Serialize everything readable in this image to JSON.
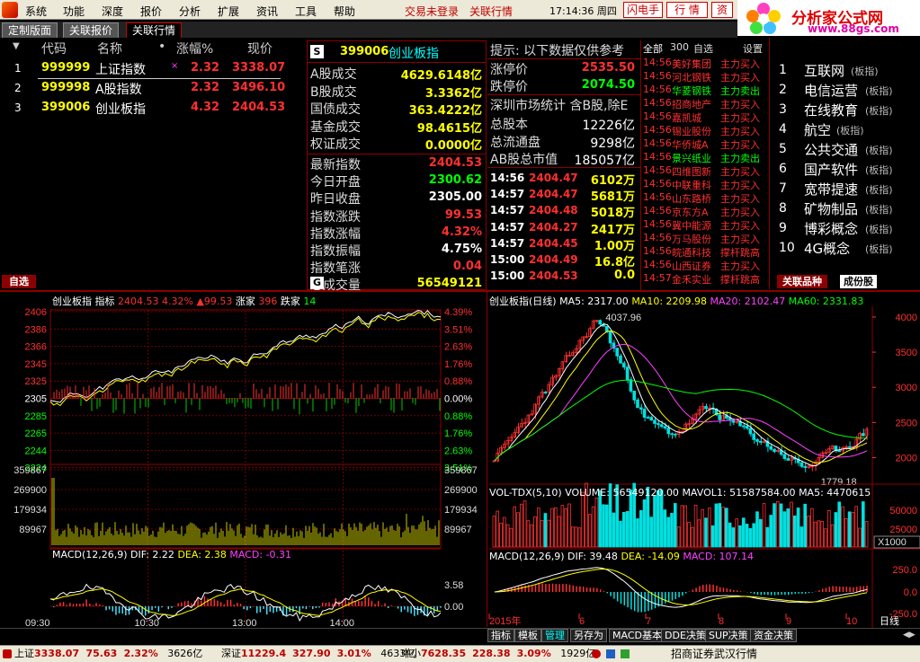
{
  "menu": {
    "items": [
      "系统",
      "功能",
      "深度",
      "报价",
      "分析",
      "扩展",
      "资讯",
      "工具",
      "帮助"
    ],
    "trade_status": "交易未登录",
    "related_quotes": "关联行情",
    "clock": "17:14:36 周四",
    "btn_flash": "闪电手",
    "btn_quote": "行 情",
    "btn_info": "资"
  },
  "brand": {
    "name": "分析家公式网",
    "url": "www.88gs.com"
  },
  "tabs": [
    "定制版面",
    "关联报价",
    "关联行情"
  ],
  "watchlist": {
    "headers": {
      "code": "代码",
      "name": "名称",
      "dot": "•",
      "change_pct": "涨幅%",
      "price": "现价"
    },
    "rows": [
      {
        "idx": "1",
        "code": "999999",
        "name": "上证指数",
        "mark": "×",
        "change": "2.32",
        "price": "3338.07"
      },
      {
        "idx": "2",
        "code": "999998",
        "name": "A股指数",
        "mark": "",
        "change": "2.32",
        "price": "3496.10"
      },
      {
        "idx": "3",
        "code": "399006",
        "name": "创业板指",
        "mark": "",
        "change": "4.32",
        "price": "2404.53"
      }
    ],
    "footer_tab": "自选"
  },
  "index_panel": {
    "badge": "S",
    "code": "399006",
    "name": "创业板指",
    "stats": [
      {
        "label": "A股成交",
        "value": "4629.6148亿",
        "color": "#ffff00"
      },
      {
        "label": "B股成交",
        "value": "3.3362亿",
        "color": "#ffff00"
      },
      {
        "label": "国债成交",
        "value": "363.4222亿",
        "color": "#ffff00"
      },
      {
        "label": "基金成交",
        "value": "98.4615亿",
        "color": "#ffff00"
      },
      {
        "label": "权证成交",
        "value": "0.0000亿",
        "color": "#ffff00"
      }
    ],
    "quote": [
      {
        "label": "最新指数",
        "value": "2404.53",
        "color": "#ff3030"
      },
      {
        "label": "今日开盘",
        "value": "2300.62",
        "color": "#00ff00"
      },
      {
        "label": "昨日收盘",
        "value": "2305.00",
        "color": "#ffffff"
      },
      {
        "label": "指数涨跌",
        "value": "99.53",
        "color": "#ff3030"
      },
      {
        "label": "指数涨幅",
        "value": "4.32%",
        "color": "#ff3030"
      },
      {
        "label": "指数振幅",
        "value": "4.75%",
        "color": "#ffffff"
      },
      {
        "label": "指数笔涨",
        "value": "0.04",
        "color": "#ff3030"
      },
      {
        "label": "总成交量",
        "value": "56549121",
        "color": "#ffff00"
      }
    ],
    "footer_badge": "G"
  },
  "hint_panel": {
    "tip": "提示: 以下数据仅供参考",
    "limit_up_label": "涨停价",
    "limit_up": "2535.50",
    "limit_down_label": "跌停价",
    "limit_down": "2074.50",
    "stat_title": "深圳市场统计 含B股,除E",
    "total_cap_label": "总股本",
    "total_cap": "12226亿",
    "float_cap_label": "总流通盘",
    "float_cap": "9298亿",
    "mkt_val_label": "AB股总市值",
    "mkt_val": "185057亿",
    "ticks": [
      {
        "time": "14:56",
        "price": "2404.47",
        "vol": "6102万"
      },
      {
        "time": "14:57",
        "price": "2404.47",
        "vol": "5681万"
      },
      {
        "time": "14:57",
        "price": "2404.48",
        "vol": "5018万"
      },
      {
        "time": "14:57",
        "price": "2404.27",
        "vol": "2417万"
      },
      {
        "time": "14:57",
        "price": "2404.45",
        "vol": "1.00万"
      },
      {
        "time": "15:00",
        "price": "2404.49",
        "vol": "16.8亿"
      },
      {
        "time": "15:00",
        "price": "2404.53",
        "vol": "0.0"
      }
    ]
  },
  "flow_panel": {
    "header_all": "全部",
    "header_count": "300",
    "header_self": "自选",
    "header_settings": "设置",
    "items": [
      {
        "time": "14:56",
        "name": "美好集团",
        "action": "主力买入",
        "color": "#ff3030"
      },
      {
        "time": "14:56",
        "name": "河北钢铁",
        "action": "主力买入",
        "color": "#ff3030"
      },
      {
        "time": "14:56",
        "name": "华菱钢铁",
        "action": "主力卖出",
        "color": "#00ff00"
      },
      {
        "time": "14:56",
        "name": "招商地产",
        "action": "主力买入",
        "color": "#ff3030"
      },
      {
        "time": "14:56",
        "name": "嘉凯城",
        "action": "主力买入",
        "color": "#ff3030"
      },
      {
        "time": "14:56",
        "name": "锡业股份",
        "action": "主力买入",
        "color": "#ff3030"
      },
      {
        "time": "14:56",
        "name": "华侨城A",
        "action": "主力买入",
        "color": "#ff3030"
      },
      {
        "time": "14:56",
        "name": "景兴纸业",
        "action": "主力卖出",
        "color": "#00ff00"
      },
      {
        "time": "14:56",
        "name": "四维图新",
        "action": "主力买入",
        "color": "#ff3030"
      },
      {
        "time": "14:56",
        "name": "中联重科",
        "action": "主力买入",
        "color": "#ff3030"
      },
      {
        "time": "14:56",
        "name": "山东路桥",
        "action": "主力买入",
        "color": "#ff3030"
      },
      {
        "time": "14:56",
        "name": "京东方A",
        "action": "主力买入",
        "color": "#ff3030"
      },
      {
        "time": "14:56",
        "name": "冀中能源",
        "action": "主力买入",
        "color": "#ff3030"
      },
      {
        "time": "14:56",
        "name": "万马股份",
        "action": "主力买入",
        "color": "#ff3030"
      },
      {
        "time": "14:56",
        "name": "皖通科技",
        "action": "撑杆跳高",
        "color": "#ff3030"
      },
      {
        "time": "14:56",
        "name": "山西证券",
        "action": "主力买入",
        "color": "#ff3030"
      },
      {
        "time": "14:57",
        "name": "金禾实业",
        "action": "撑杆跳高",
        "color": "#ff3030"
      }
    ]
  },
  "sector_panel": {
    "items": [
      {
        "idx": "1",
        "name": "互联网",
        "tag": "(板指)"
      },
      {
        "idx": "2",
        "name": "电信运营",
        "tag": "(板指)"
      },
      {
        "idx": "3",
        "name": "在线教育",
        "tag": "(板指)"
      },
      {
        "idx": "4",
        "name": "航空",
        "tag": "(板指)"
      },
      {
        "idx": "5",
        "name": "公共交通",
        "tag": "(板指)"
      },
      {
        "idx": "6",
        "name": "国产软件",
        "tag": "(板指)"
      },
      {
        "idx": "7",
        "name": "宽带提速",
        "tag": "(板指)"
      },
      {
        "idx": "8",
        "name": "矿物制品",
        "tag": "(板指)"
      },
      {
        "idx": "9",
        "name": "博彩概念",
        "tag": "(板指)"
      },
      {
        "idx": "10",
        "name": "4G概念",
        "tag": "(板指)"
      }
    ],
    "tab1": "关联品种",
    "tab2": "成份股"
  },
  "intraday": {
    "title": "创业板指 指标 2404.53 4.32% ▲99.53 涨家 396 跌家 14",
    "title_name": "创业板指",
    "title_ind": "指标",
    "title_price": "2404.53",
    "title_pct": "4.32%",
    "title_chg": "▲99.53",
    "title_up_label": "涨家",
    "title_up": "396",
    "title_down_label": "跌家",
    "title_down": "14",
    "y_left": [
      "2406",
      "2386",
      "2366",
      "2345",
      "2325",
      "2305",
      "2285",
      "2265",
      "2244",
      "2224"
    ],
    "y_right": [
      "4.39%",
      "3.51%",
      "2.63%",
      "1.76%",
      "0.88%",
      "0.00%",
      "0.88%",
      "1.76%",
      "2.63%",
      "3.51%"
    ],
    "vol_ticks": [
      "359867",
      "269900",
      "179934",
      "89967"
    ],
    "macd_label": "MACD(12,26,9)",
    "macd_dif": "DIF: 2.22",
    "macd_dea": "DEA: 2.38",
    "macd_val": "MACD: -0.31",
    "macd_ticks": [
      "3.58",
      "0.00"
    ],
    "time_ticks": [
      "09:30",
      "10:30",
      "13:00",
      "14:00"
    ]
  },
  "daily": {
    "title_name": "创业板指(日线)",
    "ma5": "MA5: 2317.00",
    "ma10": "MA10: 2209.98",
    "ma20": "MA20: 2102.47",
    "ma60": "MA60: 2331.83",
    "y_ticks": [
      "4000",
      "3500",
      "3000",
      "2500",
      "2000"
    ],
    "high_label": "4037.96",
    "low_label": "1779.18",
    "vol_title": "VOL-TDX(5,10)",
    "vol_volume": "VOLUME: 56549120.00",
    "vol_mavol1": "MAVOL1: 51587584.00",
    "vol_ma5": "MA5: 4470615",
    "vol_ticks": [
      "50000",
      "25000"
    ],
    "vol_unit": "X1000",
    "macd_label": "MACD(12,26,9)",
    "macd_dif": "DIF: 39.48",
    "macd_dea": "DEA: -14.09",
    "macd_val": "MACD: 107.14",
    "macd_ticks": [
      "250.0",
      "0.0",
      "-250.0"
    ],
    "x_ticks": [
      "2015年",
      "6",
      "7",
      "8",
      "9",
      "10"
    ],
    "period": "日线"
  },
  "bottom_tabs": [
    "指标",
    "模板",
    "管理",
    "另存为",
    "MACD基本",
    "DDE决策",
    "SUP决策",
    "资金决策"
  ],
  "status": {
    "sh_label": "上证",
    "sh_price": "3338.07",
    "sh_chg": "75.63",
    "sh_pct": "2.32%",
    "sh_amt": "3626亿",
    "sz_label": "深证",
    "sz_price": "11229.4",
    "sz_chg": "327.90",
    "sz_pct": "3.01%",
    "sz_amt": "4633亿",
    "zx_label": "中小",
    "zx_price": "7628.35",
    "zx_chg": "228.38",
    "zx_pct": "3.09%",
    "zx_amt": "1929亿",
    "broker": "招商证券武汉行情"
  }
}
